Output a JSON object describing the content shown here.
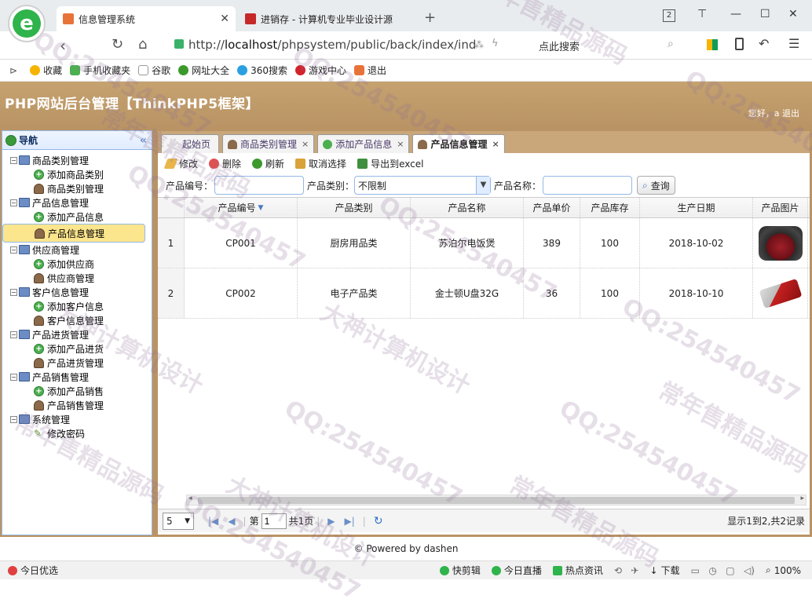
{
  "browser": {
    "tabs": [
      {
        "title": "信息管理系统",
        "active": true
      },
      {
        "title": "进销存 - 计算机专业毕业设计源",
        "active": false
      }
    ],
    "new_tab": "+",
    "tab_count": "2",
    "url_prefix": "http://",
    "url_host": "localhost",
    "url_path": "/phpsystem/public/back/index/ind",
    "search_placeholder": "点此搜索",
    "bookmarks": [
      "收藏",
      "手机收藏夹",
      "谷歌",
      "网址大全",
      "360搜索",
      "游戏中心",
      "退出"
    ]
  },
  "app": {
    "title": "PHP网站后台管理【ThinkPHP5框架】",
    "greeting": "您好，a",
    "logout": "退出",
    "accent_color": "#c5a26f"
  },
  "nav": {
    "title": "导航",
    "collapse": "«",
    "groups": [
      {
        "label": "商品类别管理",
        "items": [
          {
            "label": "添加商品类别",
            "icon": "add-icon"
          },
          {
            "label": "商品类别管理",
            "icon": "user-icon"
          }
        ]
      },
      {
        "label": "产品信息管理",
        "items": [
          {
            "label": "添加产品信息",
            "icon": "add-icon"
          },
          {
            "label": "产品信息管理",
            "icon": "user-icon",
            "selected": true
          }
        ]
      },
      {
        "label": "供应商管理",
        "items": [
          {
            "label": "添加供应商",
            "icon": "add-icon"
          },
          {
            "label": "供应商管理",
            "icon": "user-icon"
          }
        ]
      },
      {
        "label": "客户信息管理",
        "items": [
          {
            "label": "添加客户信息",
            "icon": "add-icon"
          },
          {
            "label": "客户信息管理",
            "icon": "user-icon"
          }
        ]
      },
      {
        "label": "产品进货管理",
        "items": [
          {
            "label": "添加产品进货",
            "icon": "add-icon"
          },
          {
            "label": "产品进货管理",
            "icon": "user-icon"
          }
        ]
      },
      {
        "label": "产品销售管理",
        "items": [
          {
            "label": "添加产品销售",
            "icon": "add-icon"
          },
          {
            "label": "产品销售管理",
            "icon": "user-icon"
          }
        ]
      },
      {
        "label": "系统管理",
        "items": [
          {
            "label": "修改密码",
            "icon": "pencil-icon"
          }
        ]
      }
    ]
  },
  "page_tabs": [
    {
      "label": "起始页",
      "closable": false
    },
    {
      "label": "商品类别管理",
      "closable": true
    },
    {
      "label": "添加产品信息",
      "closable": true
    },
    {
      "label": "产品信息管理",
      "closable": true,
      "active": true
    }
  ],
  "toolbar": {
    "edit": "修改",
    "delete": "删除",
    "refresh": "刷新",
    "unselect": "取消选择",
    "export": "导出到excel"
  },
  "filter": {
    "code_label": "产品编号：",
    "code_value": "",
    "category_label": "产品类别：",
    "category_value": "不限制",
    "name_label": "产品名称：",
    "name_value": "",
    "query_button": "查询"
  },
  "grid": {
    "columns": [
      "产品编号",
      "产品类别",
      "产品名称",
      "产品单价",
      "产品库存",
      "生产日期",
      "产品图片"
    ],
    "rows": [
      {
        "no": "1",
        "code": "CP001",
        "category": "厨房用品类",
        "name": "苏泊尔电饭煲",
        "price": "389",
        "stock": "100",
        "date": "2018-10-02",
        "image": "rice-cooker"
      },
      {
        "no": "2",
        "code": "CP002",
        "category": "电子产品类",
        "name": "金士顿U盘32G",
        "price": "36",
        "stock": "100",
        "date": "2018-10-10",
        "image": "usb-drive"
      }
    ]
  },
  "pager": {
    "page_size": "5",
    "page_prefix": "第",
    "page_value": "1",
    "page_suffix": "共1页",
    "summary": "显示1到2,共2记录"
  },
  "footer": "© Powered by dashen",
  "statusbar": {
    "left": "今日优选",
    "items": [
      "快剪辑",
      "今日直播",
      "热点资讯"
    ],
    "download": "下载",
    "zoom": "100%"
  },
  "watermarks": [
    "QQ:254540457",
    "常年售精品源码",
    "大神计算机设计"
  ]
}
